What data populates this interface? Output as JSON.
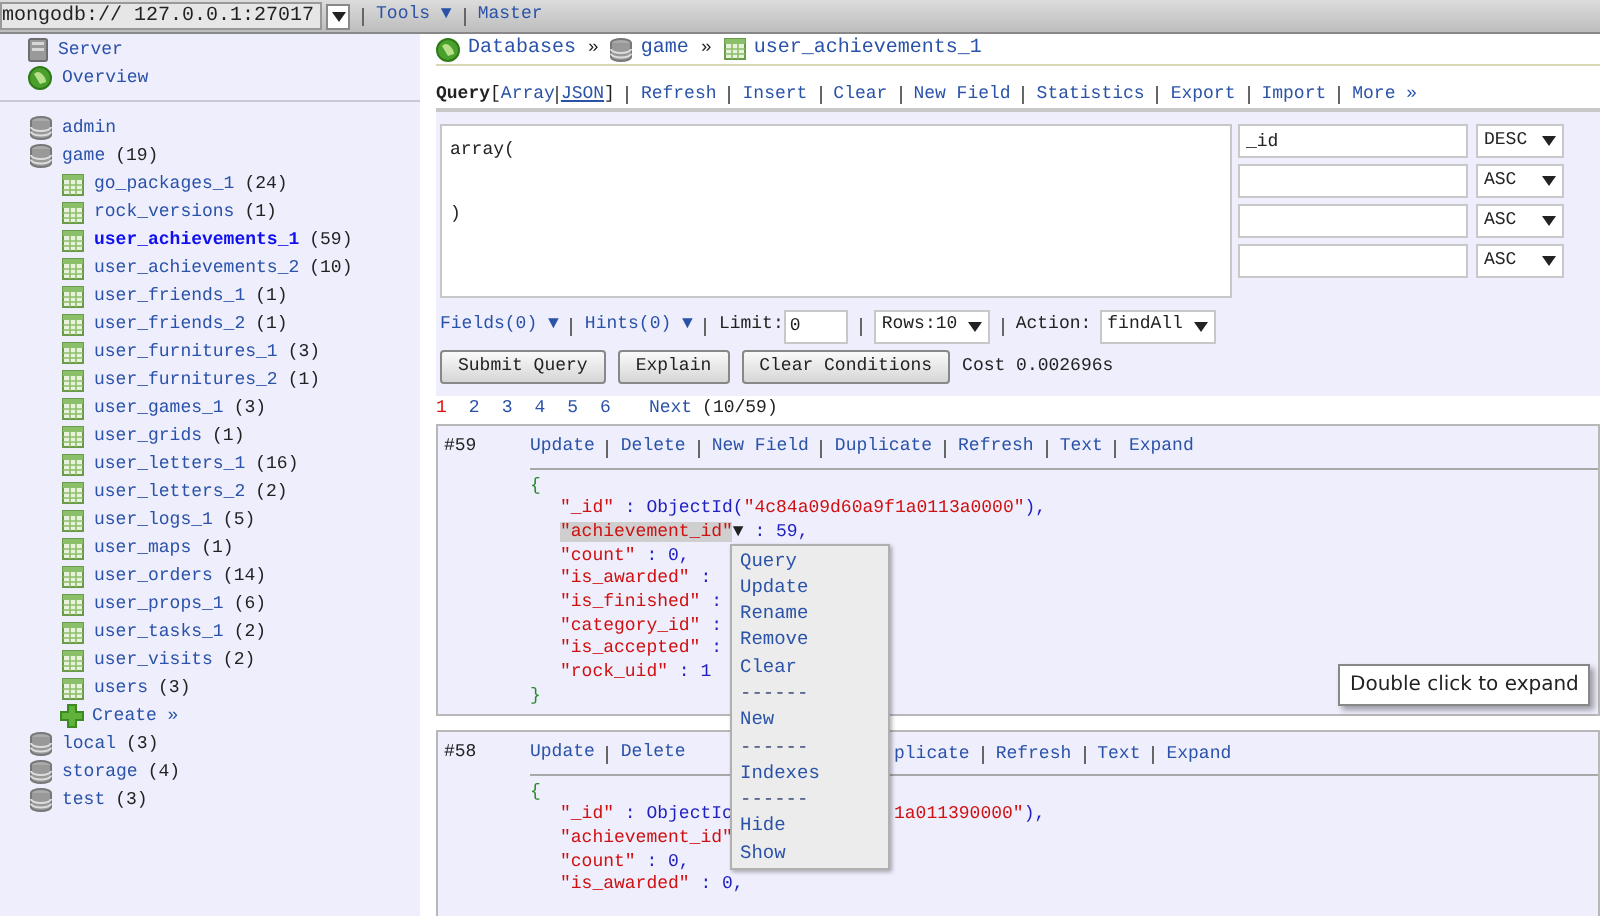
{
  "connection": {
    "host": "mongodb:// 127.0.0.1:27017",
    "menus": [
      "Tools ▼",
      "Master"
    ]
  },
  "sidebar": {
    "top_items": [
      {
        "label": "Server",
        "kind": "server"
      },
      {
        "label": "Overview",
        "kind": "globe"
      }
    ],
    "databases": [
      {
        "name": "admin"
      },
      {
        "name": "game",
        "count": "(19)",
        "collections": [
          {
            "name": "go_packages_1",
            "count": "(24)",
            "selected": false
          },
          {
            "name": "rock_versions",
            "count": "(1)",
            "selected": false
          },
          {
            "name": "user_achievements_1",
            "count": "(59)",
            "selected": true
          },
          {
            "name": "user_achievements_2",
            "count": "(10)",
            "selected": false
          },
          {
            "name": "user_friends_1",
            "count": "(1)",
            "selected": false
          },
          {
            "name": "user_friends_2",
            "count": "(1)",
            "selected": false
          },
          {
            "name": "user_furnitures_1",
            "count": "(3)",
            "selected": false
          },
          {
            "name": "user_furnitures_2",
            "count": "(1)",
            "selected": false
          },
          {
            "name": "user_games_1",
            "count": "(3)",
            "selected": false
          },
          {
            "name": "user_grids",
            "count": "(1)",
            "selected": false
          },
          {
            "name": "user_letters_1",
            "count": "(16)",
            "selected": false
          },
          {
            "name": "user_letters_2",
            "count": "(2)",
            "selected": false
          },
          {
            "name": "user_logs_1",
            "count": "(5)",
            "selected": false
          },
          {
            "name": "user_maps",
            "count": "(1)",
            "selected": false
          },
          {
            "name": "user_orders",
            "count": "(14)",
            "selected": false
          },
          {
            "name": "user_props_1",
            "count": "(6)",
            "selected": false
          },
          {
            "name": "user_tasks_1",
            "count": "(2)",
            "selected": false
          },
          {
            "name": "user_visits",
            "count": "(2)",
            "selected": false
          },
          {
            "name": "users",
            "count": "(3)",
            "selected": false
          }
        ],
        "create": "Create »"
      },
      {
        "name": "local",
        "count": "(3)"
      },
      {
        "name": "storage",
        "count": "(4)"
      },
      {
        "name": "test",
        "count": "(3)"
      }
    ]
  },
  "breadcrumb": {
    "separator": "»",
    "items": [
      {
        "label": "Databases",
        "kind": "globe"
      },
      {
        "label": "game",
        "kind": "database"
      },
      {
        "label": "user_achievements_1",
        "kind": "table"
      }
    ]
  },
  "toolbar": {
    "label": "Query",
    "open": "[",
    "close": "]",
    "modes": [
      {
        "label": "Array",
        "selected": false
      },
      {
        "label": "JSON",
        "selected": true
      }
    ],
    "actions": [
      "Refresh",
      "Insert",
      "Clear",
      "New Field",
      "Statistics",
      "Export",
      "Import",
      "More »"
    ]
  },
  "query": {
    "text": "array(\n\n)",
    "sort": [
      {
        "field": "_id",
        "order": "DESC"
      },
      {
        "order": "ASC"
      },
      {
        "order": "ASC"
      },
      {
        "order": "ASC"
      }
    ],
    "fields": "Fields(0) ▼",
    "hints": "Hints(0) ▼",
    "limit_label": "Limit:",
    "limit": "0",
    "rows": "Rows:10",
    "action_label": "Action:",
    "action": "findAll",
    "buttons": [
      "Submit Query",
      "Explain",
      "Clear Conditions"
    ],
    "cost": "Cost 0.002696s"
  },
  "pagination": {
    "pages": [
      {
        "label": "1",
        "selected": true
      },
      {
        "label": "2",
        "selected": false
      },
      {
        "label": "3",
        "selected": false
      },
      {
        "label": "4",
        "selected": false
      },
      {
        "label": "5",
        "selected": false
      },
      {
        "label": "6",
        "selected": false
      }
    ],
    "next": "Next",
    "count": "(10/59)"
  },
  "records": [
    {
      "number": "#59",
      "actions": [
        "Update",
        "Delete",
        "New Field",
        "Duplicate",
        "Refresh",
        "Text",
        "Expand"
      ],
      "lines": [
        {
          "kind": "brace",
          "text": "{"
        },
        {
          "kind": "field",
          "parts": [
            {
              "kind": "key",
              "text": "\"_id\""
            },
            {
              "kind": "punct",
              "text": " : ObjectId("
            },
            {
              "kind": "string",
              "text": "\"4c84a09d60a9f1a0113a0000\""
            },
            {
              "kind": "punct",
              "text": "),"
            }
          ]
        },
        {
          "kind": "field",
          "parts": [
            {
              "kind": "active_key",
              "text": "\"achievement_id\""
            },
            {
              "kind": "caret",
              "text": "▼"
            },
            {
              "kind": "punct",
              "text": " : 59,"
            }
          ]
        },
        {
          "kind": "field",
          "parts": [
            {
              "kind": "key",
              "text": "\"count\""
            },
            {
              "kind": "punct",
              "text": " : 0,"
            }
          ]
        },
        {
          "kind": "field",
          "parts": [
            {
              "kind": "key",
              "text": "\"is_awarded\""
            },
            {
              "kind": "punct",
              "text": " :"
            }
          ]
        },
        {
          "kind": "field",
          "parts": [
            {
              "kind": "key",
              "text": "\"is_finished\""
            },
            {
              "kind": "punct",
              "text": " :"
            }
          ]
        },
        {
          "kind": "field",
          "parts": [
            {
              "kind": "key",
              "text": "\"category_id\""
            },
            {
              "kind": "punct",
              "text": " :"
            }
          ]
        },
        {
          "kind": "field",
          "parts": [
            {
              "kind": "key",
              "text": "\"is_accepted\""
            },
            {
              "kind": "punct",
              "text": " :"
            }
          ]
        },
        {
          "kind": "field",
          "parts": [
            {
              "kind": "key",
              "text": "\"rock_uid\""
            },
            {
              "kind": "punct",
              "text": " : 1"
            }
          ]
        },
        {
          "kind": "brace",
          "text": "}"
        }
      ],
      "context_menu": [
        {
          "kind": "item",
          "label": "Query"
        },
        {
          "kind": "item",
          "label": "Update"
        },
        {
          "kind": "item",
          "label": "Rename"
        },
        {
          "kind": "item",
          "label": "Remove"
        },
        {
          "kind": "item",
          "label": "Clear"
        },
        {
          "kind": "separator",
          "label": "------"
        },
        {
          "kind": "item",
          "label": "New"
        },
        {
          "kind": "separator",
          "label": "------"
        },
        {
          "kind": "item",
          "label": "Indexes"
        },
        {
          "kind": "separator",
          "label": "------"
        },
        {
          "kind": "item",
          "label": "Hide"
        },
        {
          "kind": "item",
          "label": "Show"
        }
      ],
      "tooltip": "Double click to expand"
    },
    {
      "number": "#58",
      "actions": [
        "Update",
        "Delete"
      ],
      "actions_after": [
        "plicate",
        "Refresh",
        "Text",
        "Expand"
      ],
      "lines": [
        {
          "kind": "brace",
          "text": "{"
        },
        {
          "kind": "field",
          "parts": [
            {
              "kind": "key",
              "text": "\"_id\""
            },
            {
              "kind": "punct",
              "text": " : ObjectIc"
            }
          ],
          "after": [
            {
              "kind": "string",
              "text": "1a011390000\""
            },
            {
              "kind": "punct",
              "text": "),"
            }
          ]
        },
        {
          "kind": "field",
          "parts": [
            {
              "kind": "key",
              "text": "\"achievement_id\""
            }
          ]
        },
        {
          "kind": "field",
          "parts": [
            {
              "kind": "key",
              "text": "\"count\""
            },
            {
              "kind": "punct",
              "text": " : 0,"
            }
          ]
        },
        {
          "kind": "field",
          "parts": [
            {
              "kind": "key",
              "text": "\"is_awarded\""
            },
            {
              "kind": "punct",
              "text": " : 0,"
            }
          ]
        }
      ]
    }
  ]
}
